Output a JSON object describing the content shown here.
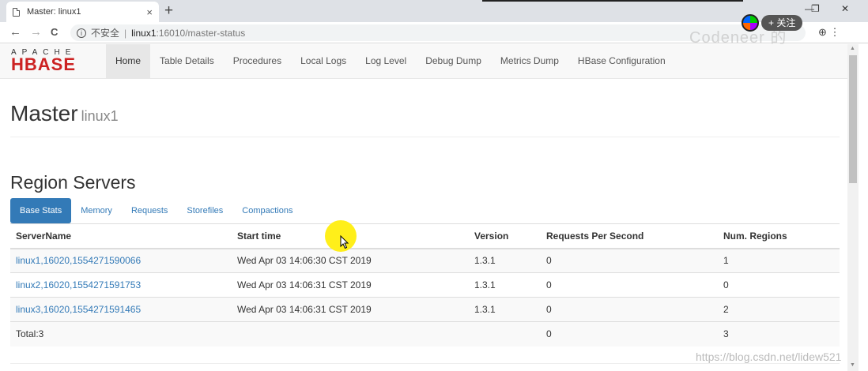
{
  "browser": {
    "tab_title": "Master: linux1",
    "tab_close": "×",
    "new_tab": "+",
    "win_minimize": "—",
    "win_restore": "❐",
    "win_close": "✕",
    "back": "←",
    "forward": "→",
    "reload": "C",
    "info": "i",
    "insecure_label": "不安全",
    "separator": "|",
    "url_host": "linux1",
    "url_path": ":16010/master-status",
    "follow_label": "+ 关注",
    "watermark_top": "Codeneer 的",
    "ext_icons": "⊕ ⋮"
  },
  "navbar": {
    "logo_top": "APACHE",
    "logo_bottom": "HBASE",
    "items": [
      {
        "label": "Home",
        "active": true
      },
      {
        "label": "Table Details"
      },
      {
        "label": "Procedures"
      },
      {
        "label": "Local Logs"
      },
      {
        "label": "Log Level"
      },
      {
        "label": "Debug Dump"
      },
      {
        "label": "Metrics Dump"
      },
      {
        "label": "HBase Configuration"
      }
    ]
  },
  "master": {
    "title": "Master",
    "host": "linux1"
  },
  "region_servers": {
    "title": "Region Servers",
    "tabs": [
      {
        "label": "Base Stats",
        "active": true
      },
      {
        "label": "Memory"
      },
      {
        "label": "Requests"
      },
      {
        "label": "Storefiles"
      },
      {
        "label": "Compactions"
      }
    ],
    "columns": [
      "ServerName",
      "Start time",
      "Version",
      "Requests Per Second",
      "Num. Regions"
    ],
    "rows": [
      [
        "linux1,16020,1554271590066",
        "Wed Apr 03 14:06:30 CST 2019",
        "1.3.1",
        "0",
        "1"
      ],
      [
        "linux2,16020,1554271591753",
        "Wed Apr 03 14:06:31 CST 2019",
        "1.3.1",
        "0",
        "0"
      ],
      [
        "linux3,16020,1554271591465",
        "Wed Apr 03 14:06:31 CST 2019",
        "1.3.1",
        "0",
        "2"
      ]
    ],
    "total": [
      "Total:3",
      "",
      "",
      "0",
      "3"
    ]
  },
  "watermark_bottom": "https://blog.csdn.net/lidew521",
  "colors": {
    "link": "#337ab7",
    "active_tab": "#337ab7",
    "logo_red": "#cc2222",
    "cursor_halo": "#ffef1a"
  }
}
